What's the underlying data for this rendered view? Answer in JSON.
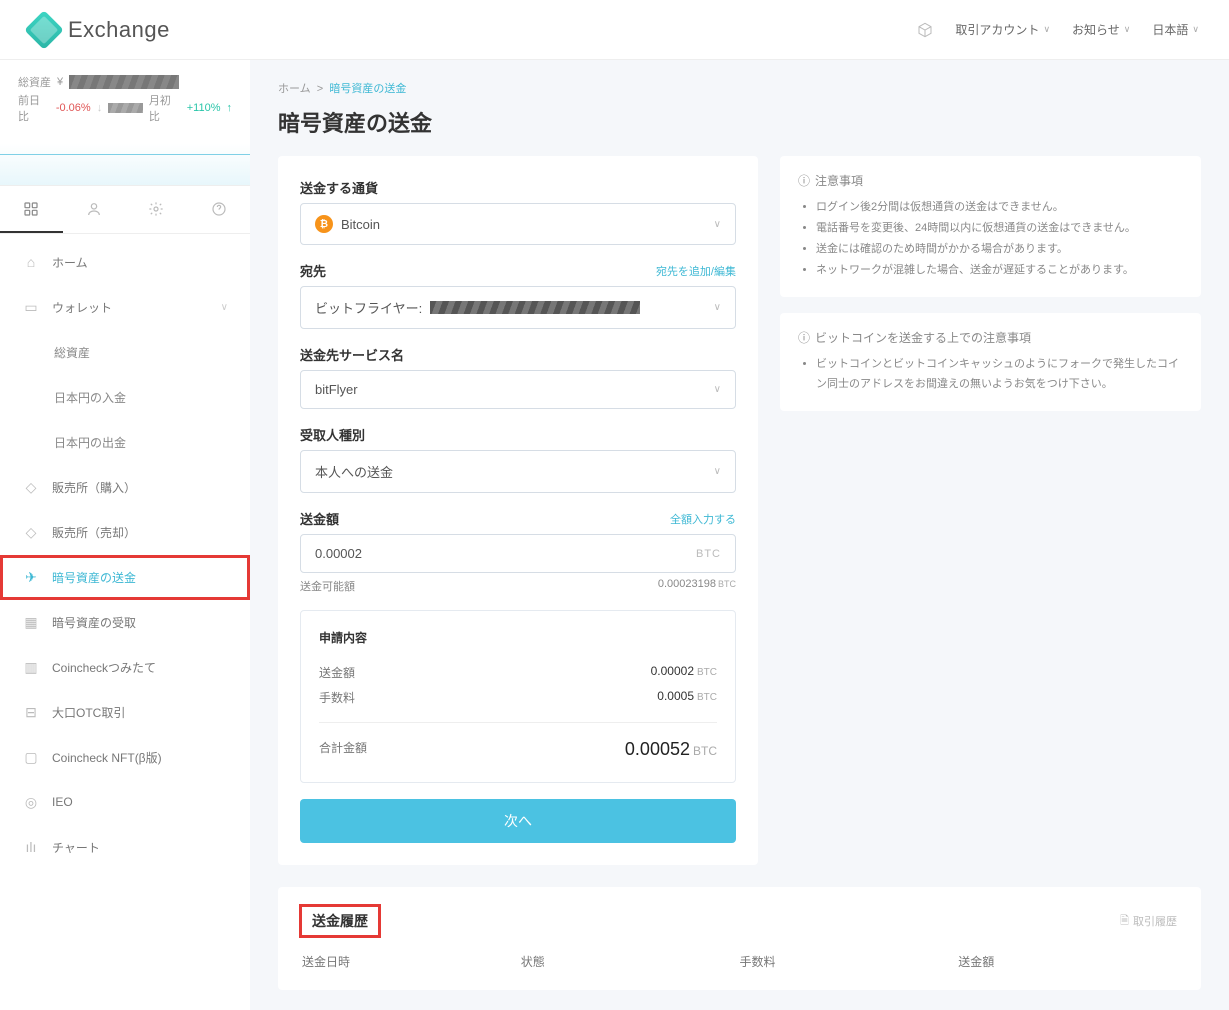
{
  "header": {
    "brand": "Exchange",
    "menu": {
      "account": "取引アカウント",
      "notice": "お知らせ",
      "language": "日本語"
    }
  },
  "sidebar": {
    "balance_label": "総資産",
    "balance_currency": "¥",
    "change_label": "前日比",
    "change_neg": "-0.06%",
    "change_label2": "月初比",
    "change_pos": "+110%",
    "nav": {
      "home": "ホーム",
      "wallet": "ウォレット",
      "wallet_total": "総資産",
      "wallet_deposit": "日本円の入金",
      "wallet_withdraw": "日本円の出金",
      "buy": "販売所（購入）",
      "sell": "販売所（売却）",
      "send": "暗号資産の送金",
      "receive": "暗号資産の受取",
      "tsumitate": "Coincheckつみたて",
      "otc": "大口OTC取引",
      "nft": "Coincheck NFT(β版)",
      "ieo": "IEO",
      "chart": "チャート"
    }
  },
  "breadcrumb": {
    "home": "ホーム",
    "current": "暗号資産の送金"
  },
  "page_title": "暗号資産の送金",
  "form": {
    "currency_label": "送金する通貨",
    "currency_value": "Bitcoin",
    "dest_label": "宛先",
    "dest_link": "宛先を追加/編集",
    "dest_value_prefix": "ビットフライヤー:",
    "service_label": "送金先サービス名",
    "service_value": "bitFlyer",
    "recipient_label": "受取人種別",
    "recipient_value": "本人への送金",
    "amount_label": "送金額",
    "amount_link": "全額入力する",
    "amount_value": "0.00002",
    "amount_unit": "BTC",
    "available_label": "送金可能額",
    "available_value": "0.00023198",
    "available_unit": "BTC",
    "summary": {
      "title": "申請内容",
      "amount_label": "送金額",
      "amount_value": "0.00002",
      "fee_label": "手数料",
      "fee_value": "0.0005",
      "total_label": "合計金額",
      "total_value": "0.00052",
      "unit": "BTC"
    },
    "next": "次へ"
  },
  "notices": {
    "box1_title": "注意事項",
    "box1_items": [
      "ログイン後2分間は仮想通貨の送金はできません。",
      "電話番号を変更後、24時間以内に仮想通貨の送金はできません。",
      "送金には確認のため時間がかかる場合があります。",
      "ネットワークが混雑した場合、送金が遅延することがあります。"
    ],
    "box2_title": "ビットコインを送金する上での注意事項",
    "box2_items": [
      "ビットコインとビットコインキャッシュのようにフォークで発生したコイン同士のアドレスをお間違えの無いようお気をつけ下さい。"
    ]
  },
  "history": {
    "title": "送金履歴",
    "link": "取引履歴",
    "cols": {
      "date": "送金日時",
      "status": "状態",
      "fee": "手数料",
      "amount": "送金額"
    }
  }
}
